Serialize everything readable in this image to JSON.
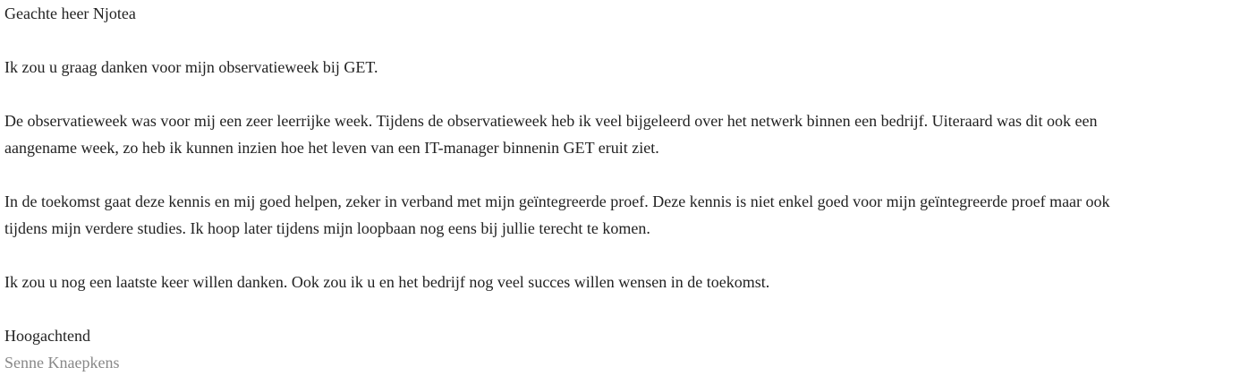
{
  "letter": {
    "salutation": "Geachte heer Njotea",
    "paragraph1": "Ik zou u graag danken voor mijn observatieweek bij GET.",
    "paragraph2": {
      "line1": "De observatieweek was voor mij een zeer leerrijke week. Tijdens de observatieweek heb ik veel bijgeleerd over het netwerk binnen een bedrijf. Uiteraard was dit ook een",
      "line2": "aangename week, zo heb ik kunnen inzien hoe het leven van een IT-manager binnenin GET eruit ziet."
    },
    "paragraph3": {
      "line1": "In de toekomst gaat deze kennis en mij goed helpen, zeker in verband met mijn geïntegreerde proef. Deze kennis is niet enkel goed voor mijn geïntegreerde proef maar ook",
      "line2": "tijdens mijn verdere studies. Ik hoop later tijdens mijn loopbaan nog eens bij jullie terecht te komen."
    },
    "paragraph4": "Ik zou u nog een laatste keer willen danken. Ook zou ik u en het bedrijf nog veel succes willen wensen in de toekomst.",
    "closing": "Hoogachtend",
    "signature": "Senne Knaepkens"
  },
  "colors": {
    "text": "#222222",
    "signature": "#888888",
    "background": "#ffffff"
  }
}
